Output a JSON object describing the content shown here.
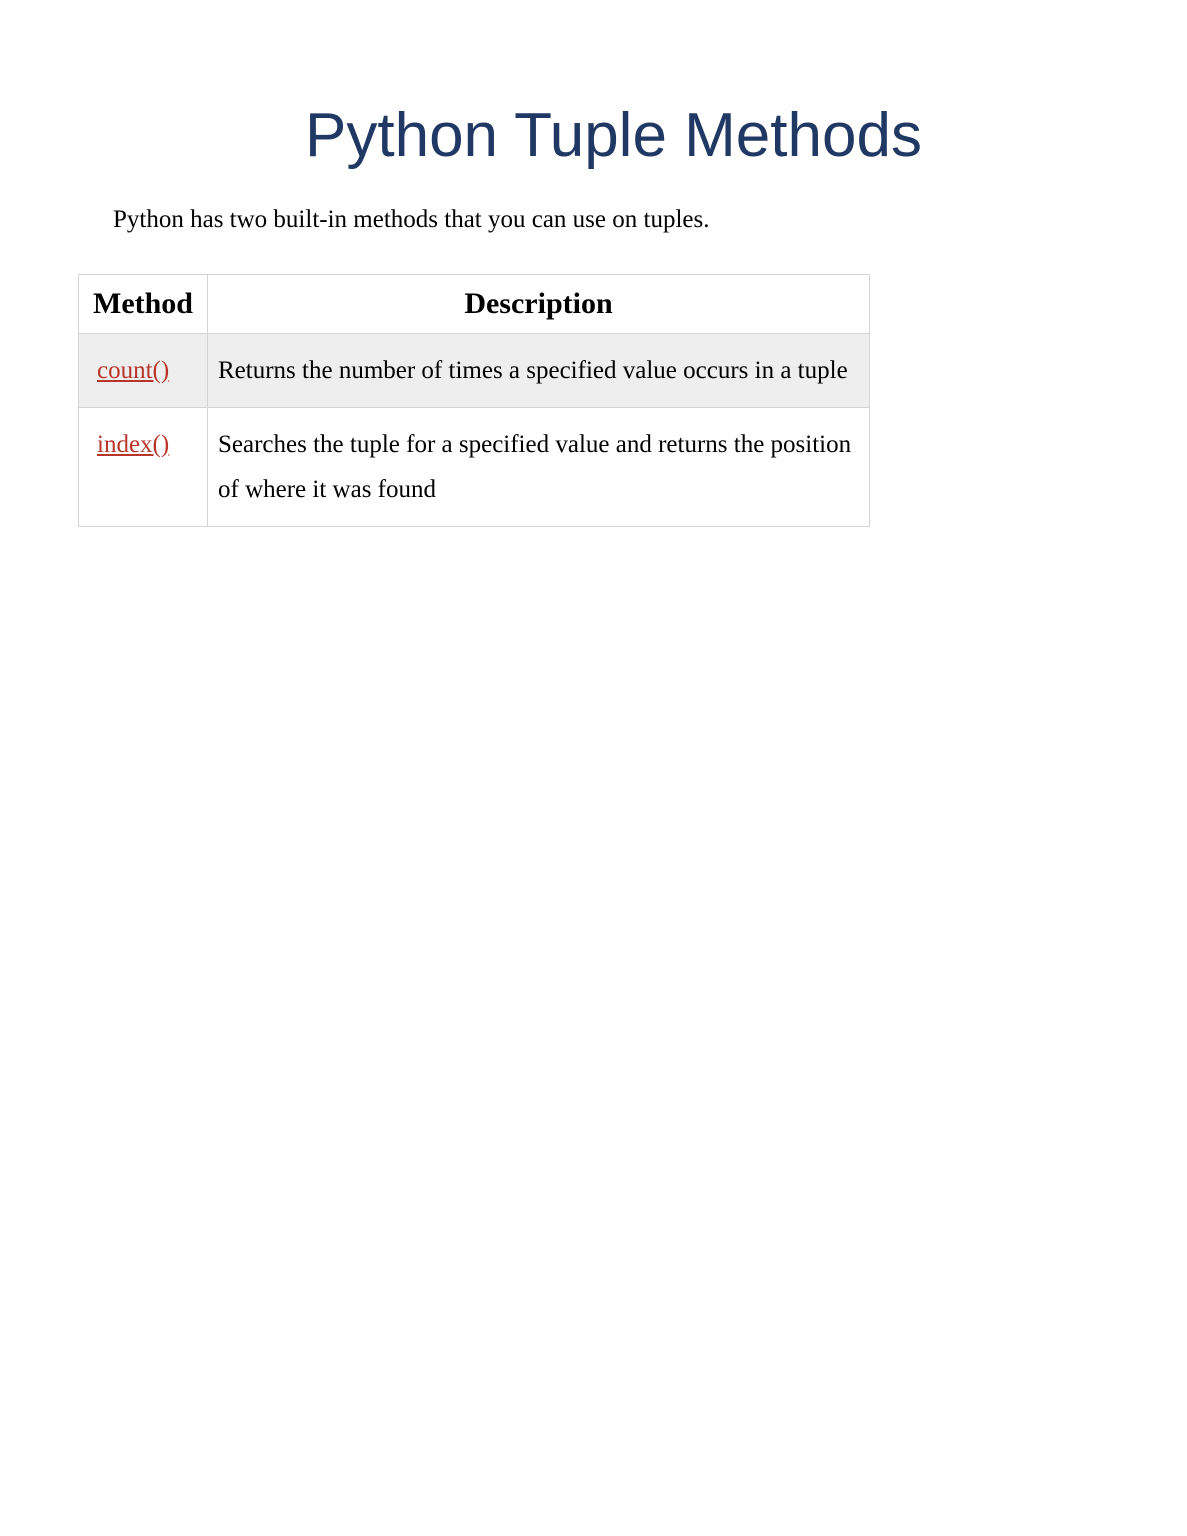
{
  "title": "Python Tuple Methods",
  "intro": "Python has two built-in methods that you can use on tuples.",
  "table": {
    "headers": {
      "method": "Method",
      "description": "Description"
    },
    "rows": [
      {
        "method": "count()",
        "description": "Returns the number of times a specified value occurs in a tuple"
      },
      {
        "method": "index()",
        "description": "Searches the tuple for a specified value and returns the position of where it was found"
      }
    ]
  }
}
